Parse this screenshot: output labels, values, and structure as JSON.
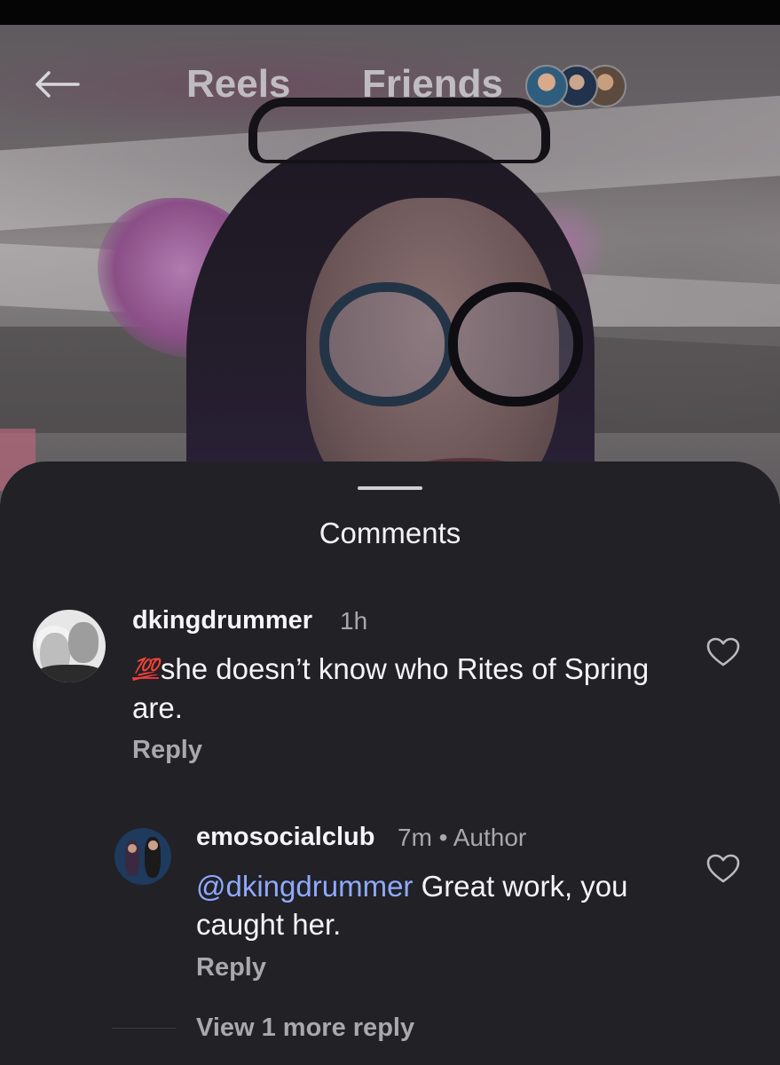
{
  "nav": {
    "back_icon": "back-arrow-icon",
    "reels_label": "Reels",
    "friends_label": "Friends",
    "friend_avatar_count": 3
  },
  "comments_sheet": {
    "title": "Comments",
    "comments": [
      {
        "username": "dkingdrummer",
        "time": "1h",
        "emoji": "💯",
        "text": "she doesn’t know who Rites of Spring are.",
        "reply_label": "Reply",
        "like_icon": "heart-outline-icon"
      },
      {
        "username": "emosocialclub",
        "meta": "7m • Author",
        "mention": "@dkingdrummer",
        "text": " Great work, you caught her.",
        "reply_label": "Reply",
        "like_icon": "heart-outline-icon"
      }
    ],
    "view_more_label": "View 1 more reply"
  },
  "colors": {
    "sheet_background": "#212126",
    "mention": "#8fa9ff",
    "secondary_text": "#a8a8ad"
  }
}
